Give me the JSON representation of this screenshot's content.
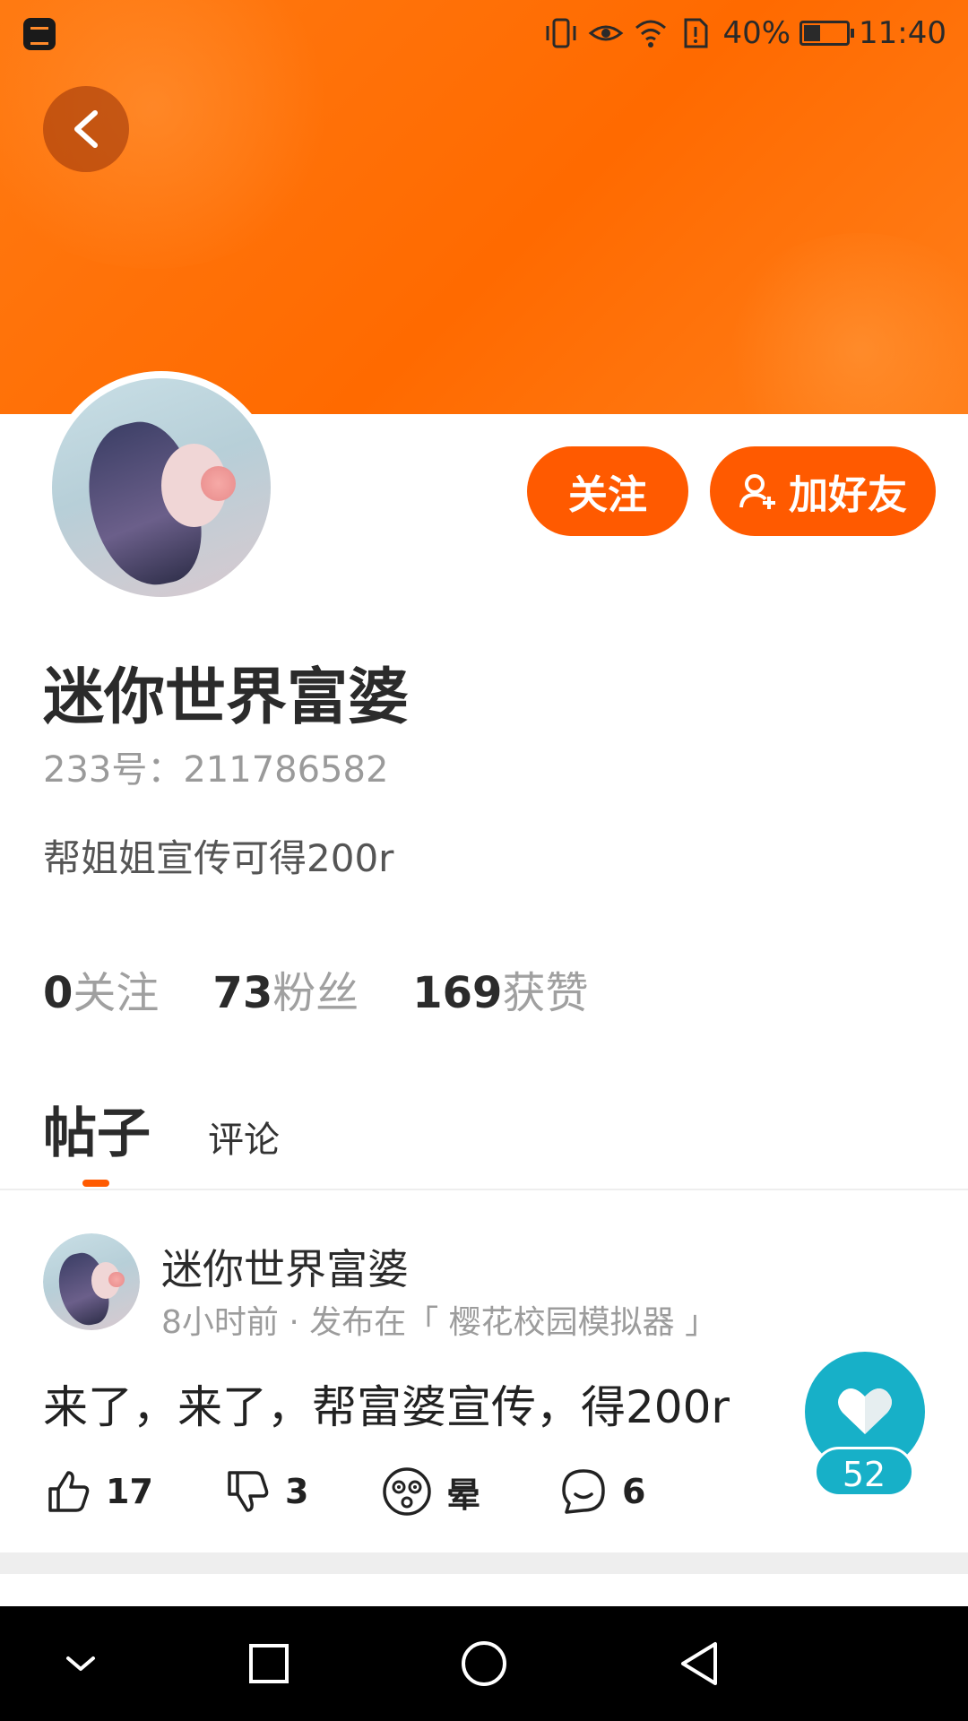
{
  "status_bar": {
    "battery": "40%",
    "battery_level": 0.4,
    "time": "11:40",
    "icons": [
      "app-icon",
      "vibrate-icon",
      "eye-icon",
      "wifi-icon",
      "sim-alert-icon",
      "battery-icon"
    ]
  },
  "header": {
    "back_icon": "chevron-left-icon",
    "banner_color": "#ff6f0f"
  },
  "profile": {
    "follow_label": "关注",
    "add_friend_label": "加好友",
    "name": "迷你世界富婆",
    "id_line": "233号：211786582",
    "bio": "帮姐姐宣传可得200r",
    "stats": [
      {
        "num": "0",
        "label": "关注"
      },
      {
        "num": "73",
        "label": "粉丝"
      },
      {
        "num": "169",
        "label": "获赞"
      }
    ]
  },
  "tabs": {
    "posts": "帖子",
    "comments": "评论"
  },
  "post": {
    "author": "迷你世界富婆",
    "meta": "8小时前 · 发布在「 樱花校园模拟器 」",
    "content": "来了，来了，帮富婆宣传，得200r",
    "likes": "17",
    "dislikes": "3",
    "dizzy": "晕",
    "comments": "6",
    "favorite_count": "52"
  },
  "colors": {
    "accent": "#ff5a00",
    "fav": "#17b0c8"
  },
  "navbar": {
    "icons": [
      "collapse-icon",
      "recents-icon",
      "home-icon",
      "back-icon"
    ]
  }
}
